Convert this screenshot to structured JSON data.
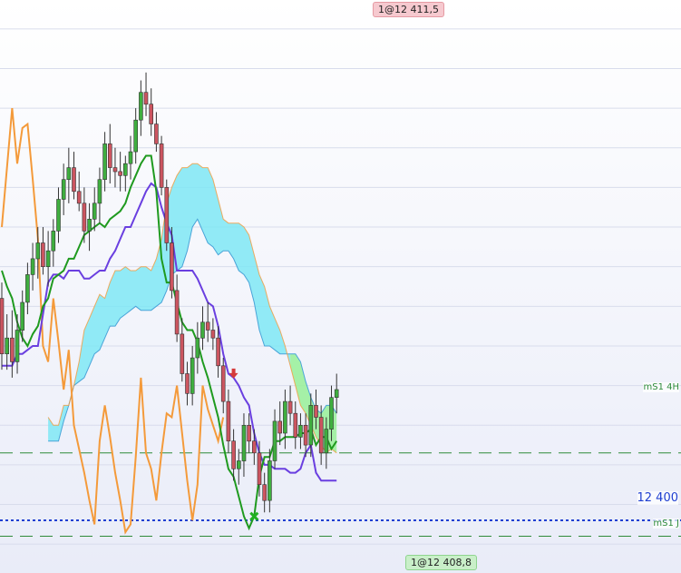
{
  "chart_data": {
    "type": "candlestick",
    "title": "",
    "xlabel": "",
    "ylabel": "",
    "grid": "horizontal",
    "price_labels": {
      "high_badge": "1@12 411,5",
      "low_badge": "1@12 408,8",
      "level_main": "12 400",
      "level_ms1_4h": "mS1 4H",
      "level_ms1_j": "mS1 J"
    },
    "levels": [
      {
        "value": 12401.3,
        "color": "#2e8b3a",
        "style": "long-dash",
        "label_key": "level_ms1_4h"
      },
      {
        "value": 12399.6,
        "color": "#1f3fd1",
        "style": "dotted",
        "label_key": "level_main"
      },
      {
        "value": 12399.2,
        "color": "#2e8b3a",
        "style": "long-dash",
        "label_key": "level_ms1_j"
      }
    ],
    "y_range": [
      12398.5,
      12412.5
    ],
    "colors": {
      "bull": "#3fae3f",
      "bear": "#cc5560",
      "tenkan": "#6a3fe0",
      "kijun": "#1f9a1f",
      "chikou": "#f49a3a",
      "cloud_bull": "#7fe8f5",
      "cloud_bear": "#98f098",
      "span_edge": "#4aa4d8"
    },
    "series": [
      {
        "name": "candles",
        "values": [
          [
            12405.2,
            12405.6,
            12403.4,
            12403.8
          ],
          [
            12403.8,
            12404.8,
            12403.4,
            12404.2
          ],
          [
            12404.2,
            12404.9,
            12403.2,
            12403.6
          ],
          [
            12403.6,
            12404.8,
            12403.3,
            12404.4
          ],
          [
            12404.4,
            12405.4,
            12404.1,
            12405.1
          ],
          [
            12405.1,
            12406.1,
            12404.8,
            12405.8
          ],
          [
            12405.8,
            12406.6,
            12405.4,
            12406.2
          ],
          [
            12406.2,
            12407.0,
            12405.7,
            12406.6
          ],
          [
            12406.6,
            12407.0,
            12405.8,
            12406.0
          ],
          [
            12406.0,
            12406.9,
            12405.5,
            12406.4
          ],
          [
            12406.4,
            12407.2,
            12406.0,
            12406.9
          ],
          [
            12406.9,
            12408.0,
            12406.6,
            12407.7
          ],
          [
            12407.7,
            12408.6,
            12407.3,
            12408.2
          ],
          [
            12408.2,
            12409.0,
            12407.6,
            12408.5
          ],
          [
            12408.5,
            12408.9,
            12407.7,
            12407.9
          ],
          [
            12407.9,
            12408.4,
            12407.4,
            12407.6
          ],
          [
            12407.6,
            12408.0,
            12406.6,
            12406.9
          ],
          [
            12406.9,
            12407.6,
            12406.4,
            12407.2
          ],
          [
            12407.2,
            12408.0,
            12406.9,
            12407.6
          ],
          [
            12407.6,
            12408.5,
            12407.1,
            12408.2
          ],
          [
            12408.2,
            12409.4,
            12407.9,
            12409.1
          ],
          [
            12409.1,
            12409.6,
            12408.1,
            12408.5
          ],
          [
            12408.5,
            12409.0,
            12408.0,
            12408.4
          ],
          [
            12408.4,
            12408.9,
            12407.9,
            12408.3
          ],
          [
            12408.3,
            12408.8,
            12407.9,
            12408.6
          ],
          [
            12408.6,
            12409.3,
            12408.2,
            12408.9
          ],
          [
            12408.9,
            12410.0,
            12408.6,
            12409.7
          ],
          [
            12409.7,
            12410.7,
            12409.3,
            12410.4
          ],
          [
            12410.4,
            12410.9,
            12409.8,
            12410.1
          ],
          [
            12410.1,
            12410.5,
            12409.3,
            12409.6
          ],
          [
            12409.6,
            12409.9,
            12408.9,
            12409.1
          ],
          [
            12409.1,
            12409.3,
            12407.8,
            12408.0
          ],
          [
            12408.0,
            12408.2,
            12406.4,
            12406.6
          ],
          [
            12406.6,
            12407.0,
            12405.2,
            12405.4
          ],
          [
            12405.4,
            12405.8,
            12404.1,
            12404.3
          ],
          [
            12404.3,
            12404.7,
            12403.1,
            12403.3
          ],
          [
            12403.3,
            12403.6,
            12402.5,
            12402.8
          ],
          [
            12402.8,
            12404.0,
            12402.5,
            12403.7
          ],
          [
            12403.7,
            12404.6,
            12403.3,
            12404.2
          ],
          [
            12404.2,
            12405.0,
            12403.9,
            12404.6
          ],
          [
            12404.6,
            12405.1,
            12404.1,
            12404.4
          ],
          [
            12404.4,
            12404.7,
            12403.9,
            12404.2
          ],
          [
            12404.2,
            12404.5,
            12403.2,
            12403.5
          ],
          [
            12403.5,
            12403.7,
            12402.3,
            12402.6
          ],
          [
            12402.6,
            12402.9,
            12401.3,
            12401.6
          ],
          [
            12401.6,
            12401.9,
            12400.6,
            12400.9
          ],
          [
            12400.9,
            12401.4,
            12400.5,
            12401.1
          ],
          [
            12401.1,
            12402.3,
            12400.7,
            12402.0
          ],
          [
            12402.0,
            12402.3,
            12401.3,
            12401.6
          ],
          [
            12401.6,
            12401.9,
            12401.0,
            12401.3
          ],
          [
            12401.3,
            12401.6,
            12400.2,
            12400.5
          ],
          [
            12400.5,
            12400.8,
            12399.8,
            12400.1
          ],
          [
            12400.1,
            12401.4,
            12399.8,
            12401.1
          ],
          [
            12401.1,
            12402.4,
            12400.9,
            12402.1
          ],
          [
            12402.1,
            12402.6,
            12401.5,
            12401.8
          ],
          [
            12401.8,
            12402.9,
            12401.4,
            12402.6
          ],
          [
            12402.6,
            12403.0,
            12402.0,
            12402.3
          ],
          [
            12402.3,
            12402.6,
            12401.4,
            12401.7
          ],
          [
            12401.7,
            12402.3,
            12401.4,
            12402.0
          ],
          [
            12402.0,
            12402.3,
            12401.2,
            12401.5
          ],
          [
            12401.5,
            12402.8,
            12401.2,
            12402.5
          ],
          [
            12402.5,
            12402.9,
            12401.9,
            12402.2
          ],
          [
            12402.2,
            12402.5,
            12401.0,
            12401.3
          ],
          [
            12401.3,
            12402.2,
            12400.9,
            12401.9
          ],
          [
            12401.9,
            12403.0,
            12401.6,
            12402.7
          ],
          [
            12402.7,
            12403.3,
            12402.3,
            12402.9
          ]
        ]
      },
      {
        "name": "tenkan",
        "values": [
          12403.5,
          12403.5,
          12403.5,
          12403.8,
          12403.8,
          12403.9,
          12404.0,
          12404.0,
          12404.8,
          12405.6,
          12405.8,
          12405.8,
          12405.7,
          12405.9,
          12405.9,
          12405.9,
          12405.7,
          12405.7,
          12405.8,
          12405.9,
          12405.9,
          12406.2,
          12406.4,
          12406.7,
          12407.0,
          12407.0,
          12407.3,
          12407.6,
          12407.9,
          12408.1,
          12408.0,
          12407.5,
          12407.1,
          12406.8,
          12405.9,
          12405.9,
          12405.9,
          12405.9,
          12405.7,
          12405.4,
          12405.1,
          12405.0,
          12404.5,
          12403.8,
          12403.3,
          12403.2,
          12403.0,
          12402.7,
          12402.5,
          12401.8,
          12401.3,
          12401.0,
          12401.0,
          12400.9,
          12400.9,
          12400.9,
          12400.8,
          12400.8,
          12400.9,
          12401.3,
          12401.5,
          12400.8,
          12400.6,
          12400.6,
          12400.6,
          12400.6
        ]
      },
      {
        "name": "kijun",
        "values": [
          12405.9,
          12405.5,
          12405.2,
          12404.6,
          12404.2,
          12404.0,
          12404.3,
          12404.5,
          12405.0,
          12405.2,
          12405.7,
          12405.8,
          12405.9,
          12406.2,
          12406.2,
          12406.5,
          12406.8,
          12406.9,
          12407.0,
          12407.1,
          12407.0,
          12407.2,
          12407.3,
          12407.4,
          12407.6,
          12408.0,
          12408.3,
          12408.6,
          12408.8,
          12408.8,
          12407.9,
          12406.2,
          12405.6,
          12405.6,
          12405.1,
          12404.6,
          12404.4,
          12404.4,
          12404.1,
          12403.6,
          12403.2,
          12402.7,
          12402.2,
          12401.5,
          12400.9,
          12400.7,
          12400.2,
          12399.7,
          12399.4,
          12399.7,
          12400.7,
          12401.2,
          12401.2,
          12401.6,
          12401.6,
          12401.7,
          12401.7,
          12401.7,
          12401.8,
          12401.8,
          12401.9,
          12401.5,
          12401.7,
          12401.7,
          12401.4,
          12401.6
        ]
      },
      {
        "name": "chikou",
        "values": [
          12407.0,
          12408.5,
          12410.0,
          12408.6,
          12409.5,
          12409.6,
          12408.2,
          12406.7,
          12404.0,
          12403.6,
          12405.2,
          12404.1,
          12402.9,
          12403.9,
          12402.0,
          12401.4,
          12400.8,
          12400.1,
          12399.5,
          12401.6,
          12402.5,
          12401.7,
          12400.8,
          12400.1,
          12399.3,
          12399.5,
          12401.2,
          12403.2,
          12401.3,
          12400.9,
          12400.1,
          12401.3,
          12402.3,
          12402.2,
          12403.0,
          12401.8,
          12400.6,
          12399.6,
          12400.5,
          12403.0,
          12402.4,
          12402.0,
          12401.6,
          12402.2
        ]
      },
      {
        "name": "span_a",
        "values": [
          12402.2,
          12402.0,
          12402.0,
          12402.5,
          12402.5,
          12403.0,
          12403.6,
          12404.4,
          12404.7,
          12405.0,
          12405.3,
          12405.2,
          12405.6,
          12405.9,
          12405.9,
          12406.0,
          12405.9,
          12405.9,
          12406.0,
          12406.0,
          12405.9,
          12406.2,
          12406.7,
          12407.6,
          12408.0,
          12408.3,
          12408.5,
          12408.5,
          12408.6,
          12408.6,
          12408.5,
          12408.5,
          12408.2,
          12407.7,
          12407.2,
          12407.1,
          12407.1,
          12407.1,
          12407.0,
          12406.8,
          12406.3,
          12405.8,
          12405.5,
          12405.0,
          12404.7,
          12404.4,
          12404.0,
          12403.5,
          12403.0,
          12402.5,
          12402.3,
          12402.0,
          12401.7,
          12401.5,
          12401.3,
          12401.4,
          12401.3
        ]
      },
      {
        "name": "span_b",
        "values": [
          12401.6,
          12401.6,
          12401.6,
          12402.1,
          12402.5,
          12403.0,
          12403.1,
          12403.2,
          12403.5,
          12403.8,
          12403.9,
          12404.2,
          12404.5,
          12404.5,
          12404.7,
          12404.8,
          12404.9,
          12405.0,
          12404.9,
          12404.9,
          12404.9,
          12405.0,
          12405.1,
          12405.4,
          12405.8,
          12405.9,
          12406.0,
          12406.4,
          12407.0,
          12407.2,
          12406.9,
          12406.6,
          12406.5,
          12406.3,
          12406.4,
          12406.4,
          12406.2,
          12405.9,
          12405.8,
          12405.6,
          12405.1,
          12404.4,
          12404.0,
          12404.0,
          12403.9,
          12403.8,
          12403.8,
          12403.8,
          12403.8,
          12403.6,
          12403.1,
          12402.7,
          12402.4,
          12402.3,
          12402.5,
          12402.5,
          12402.3
        ]
      }
    ],
    "markers": [
      {
        "type": "arrow-down",
        "bar_index": 45,
        "value": 12403.2,
        "color": "#d43a3a"
      },
      {
        "type": "cross",
        "bar_index": 49,
        "value": 12399.7,
        "color": "#22b022"
      }
    ]
  }
}
